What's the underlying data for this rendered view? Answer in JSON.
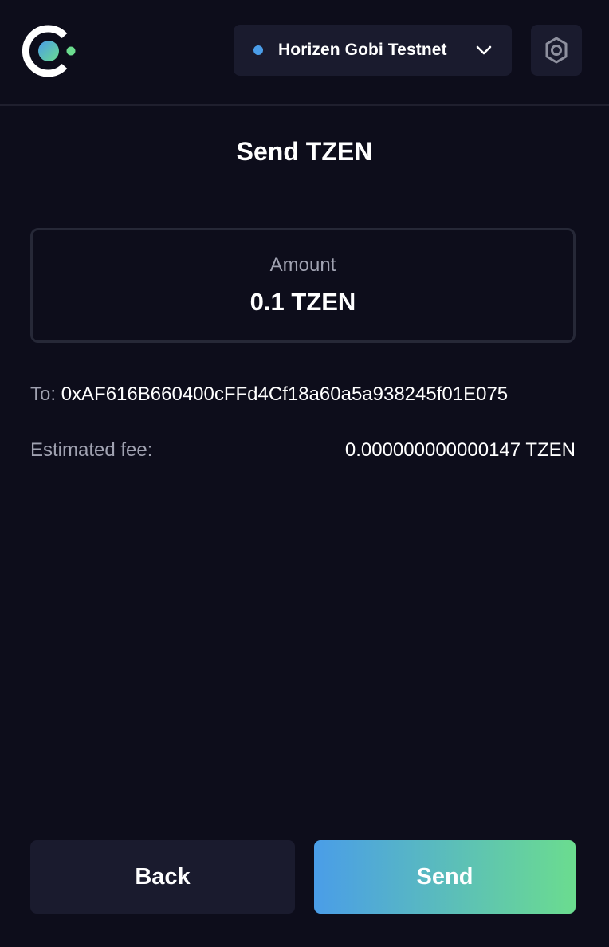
{
  "header": {
    "logo_icon": "cybermiles-logo-icon",
    "network": {
      "name": "Horizen Gobi Testnet",
      "status_color": "#4a9de8",
      "dropdown_icon": "chevron-down-icon"
    },
    "settings_icon": "hexagon-gear-icon"
  },
  "page": {
    "title": "Send TZEN"
  },
  "amount": {
    "label": "Amount",
    "value": "0.1 TZEN"
  },
  "recipient": {
    "label": "To:",
    "address": "0xAF616B660400cFFd4Cf18a60a5a938245f01E075"
  },
  "fee": {
    "label": "Estimated fee:",
    "value": "0.000000000000147 TZEN"
  },
  "actions": {
    "back_label": "Back",
    "send_label": "Send"
  },
  "colors": {
    "background": "#0d0d1b",
    "surface": "#1a1b2e",
    "accent_start": "#4a9de8",
    "accent_end": "#6bdc8f",
    "muted_text": "#a0a2b1"
  }
}
